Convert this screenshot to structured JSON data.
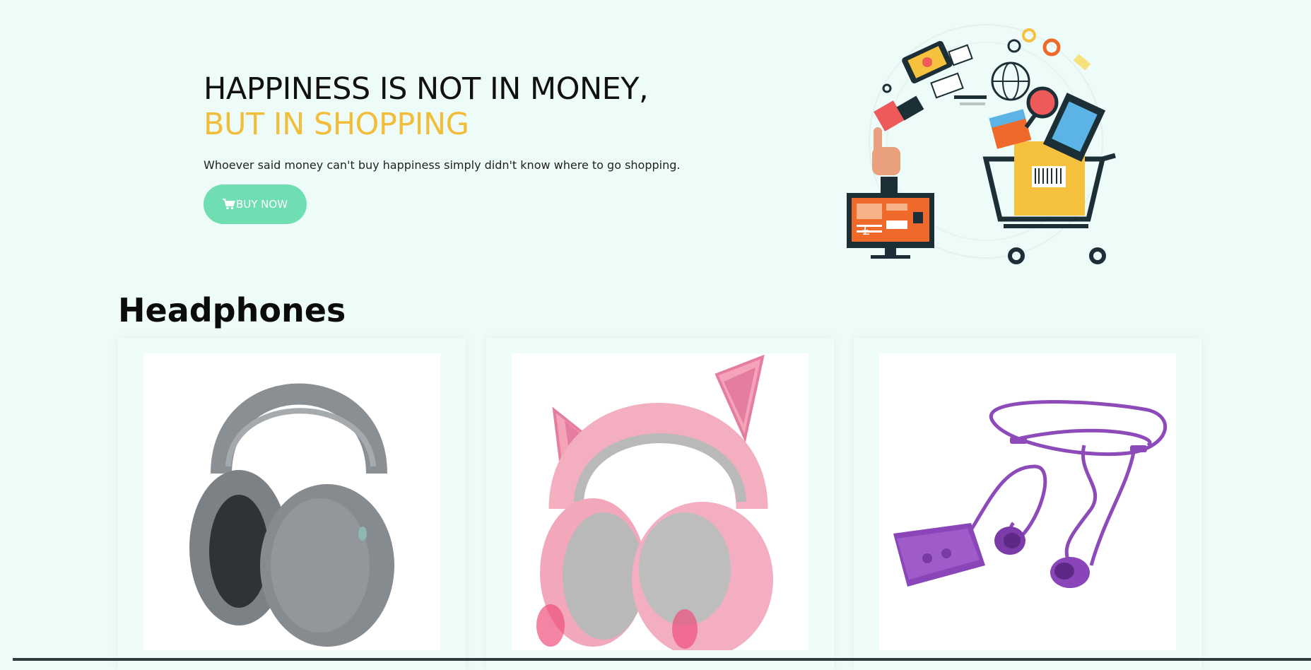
{
  "hero": {
    "title_line1": "HAPPINESS IS NOT IN MONEY,",
    "title_line2": "BUT IN SHOPPING",
    "tagline": "Whoever said money can't buy happiness simply didn't know where to go shopping.",
    "button_label": "BUY NOW",
    "button_icon": "cart-icon",
    "accent_color": "#f3bd3c",
    "button_color": "#6fdfb3",
    "illustration": "shopping-cart-illustration"
  },
  "section": {
    "title": "Headphones",
    "products": [
      {
        "image": "gray-over-ear-headphones"
      },
      {
        "image": "pink-cat-ear-headphones"
      },
      {
        "image": "purple-earbuds"
      }
    ]
  }
}
